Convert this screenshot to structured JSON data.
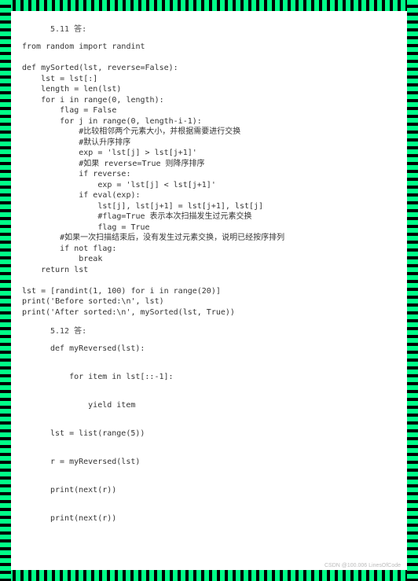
{
  "section511": {
    "heading": "5.11   答:",
    "code": "from random import randint\n\ndef mySorted(lst, reverse=False):\n    lst = lst[:]\n    length = len(lst)\n    for i in range(0, length):\n        flag = False\n        for j in range(0, length-i-1):\n            #比较相邻两个元素大小，并根据需要进行交换\n            #默认升序排序\n            exp = 'lst[j] > lst[j+1]'\n            #如果 reverse=True 则降序排序\n            if reverse:\n                exp = 'lst[j] < lst[j+1]'\n            if eval(exp):\n                lst[j], lst[j+1] = lst[j+1], lst[j]\n                #flag=True 表示本次扫描发生过元素交换\n                flag = True\n        #如果一次扫描结束后，没有发生过元素交换，说明已经按序排列\n        if not flag:\n            break\n    return lst\n\nlst = [randint(1, 100) for i in range(20)]\nprint('Before sorted:\\n', lst)\nprint('After sorted:\\n', mySorted(lst, True))"
  },
  "section512": {
    "heading": "5.12  答:",
    "code": "def myReversed(lst):\n\n    for item in lst[::-1]:\n\n        yield item\n\nlst = list(range(5))\n\nr = myReversed(lst)\n\nprint(next(r))\n\nprint(next(r))"
  },
  "watermark": "CSDN @100.006 LinesOfCode"
}
